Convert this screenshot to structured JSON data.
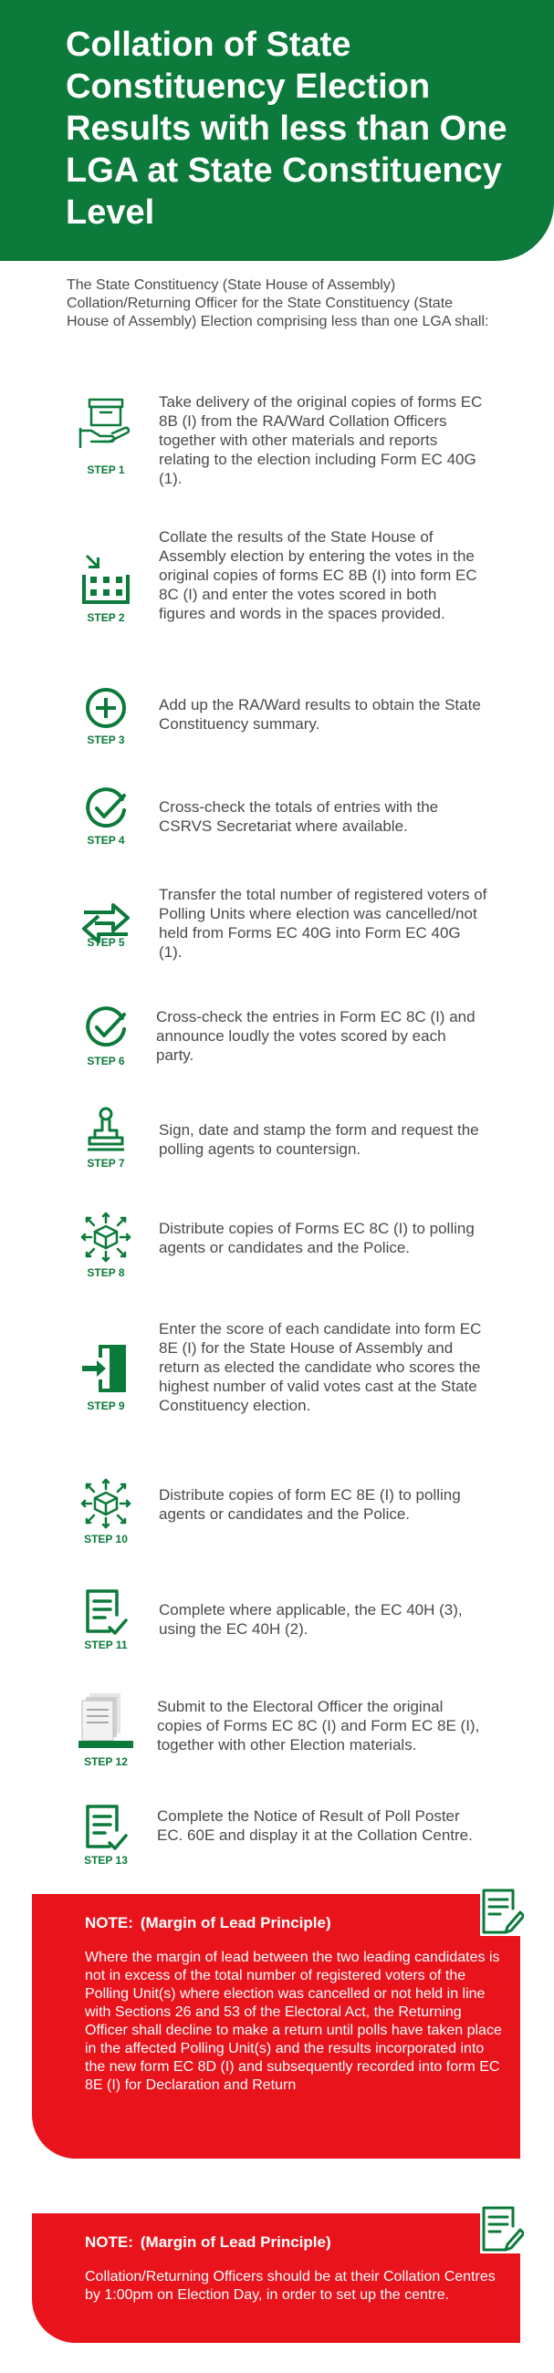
{
  "title": "Collation of State Constituency Election Results with less than One LGA at State Constituency Level",
  "intro": "The State Constituency (State House of Assembly) Collation/Returning Officer for the State Constituency (State House of Assembly) Election comprising less than one LGA shall:",
  "steps": [
    {
      "label": "STEP 1",
      "icon": "delivery-box-icon",
      "text": "Take delivery of the original copies of forms EC 8B (I) from the RA/Ward Collation Officers together with other materials and reports relating to the election including Form EC 40G (1)."
    },
    {
      "label": "STEP 2",
      "icon": "collate-grid-icon",
      "text": "Collate the results of the State House of Assembly election by entering the votes in the original copies of forms EC 8B (I) into form EC 8C (I) and enter the votes scored in both figures and words in the spaces provided."
    },
    {
      "label": "STEP 3",
      "icon": "plus-circle-icon",
      "text": "Add up the RA/Ward results to obtain the State Constituency summary."
    },
    {
      "label": "STEP 4",
      "icon": "check-circle-icon",
      "text": "Cross-check the totals of entries with the CSRVS Secretariat where available."
    },
    {
      "label": "STEP 5",
      "icon": "transfer-arrows-icon",
      "text": "Transfer the total number of registered voters of Polling Units where election was cancelled/not held from Forms EC 40G into Form EC 40G (1)."
    },
    {
      "label": "STEP 6",
      "icon": "check-circle-icon",
      "text": "Cross-check the entries in Form EC 8C (I) and announce loudly the votes scored by each party."
    },
    {
      "label": "STEP 7",
      "icon": "stamp-icon",
      "text": "Sign, date and stamp the form and request the polling agents to countersign."
    },
    {
      "label": "STEP 8",
      "icon": "distribute-icon",
      "text": "Distribute copies of Forms EC 8C (I) to polling agents or candidates and the Police."
    },
    {
      "label": "STEP 9",
      "icon": "door-enter-icon",
      "text": "Enter the score of each candidate into form EC 8E (I) for the State House of Assembly and return as elected the candidate who scores the highest number of valid votes cast at the State Constituency election."
    },
    {
      "label": "STEP 10",
      "icon": "distribute-icon",
      "text": "Distribute copies of form EC 8E (I) to polling agents or candidates and the Police."
    },
    {
      "label": "STEP 11",
      "icon": "checklist-document-icon",
      "text": "Complete where applicable, the EC 40H (3), using the EC 40H (2)."
    },
    {
      "label": "STEP 12",
      "icon": "document-stack-icon",
      "text": "Submit to the Electoral Officer the original copies of Forms EC 8C (I) and Form EC 8E (I), together with other Election materials."
    },
    {
      "label": "STEP 13",
      "icon": "checklist-document-icon",
      "text": "Complete the Notice of Result of Poll Poster EC. 60E and display it at the Collation Centre."
    }
  ],
  "notes": [
    {
      "prefix": "NOTE:",
      "heading": "(Margin of Lead Principle)",
      "icon": "document-pen-icon",
      "body": "Where the margin of lead between the two leading candidates is not in excess of the total number of registered voters of the Polling Unit(s) where election was cancelled or not held in line with Sections 26 and 53 of the Electoral Act, the Returning Officer shall decline to make a return until polls have taken place in the affected Polling Unit(s) and the results incorporated into the new form EC 8D (I) and subsequently recorded into form EC 8E (I) for Declaration and Return"
    },
    {
      "prefix": "NOTE:",
      "heading": "(Margin of Lead Principle)",
      "icon": "document-pen-icon",
      "body": "Collation/Returning Officers should be at their Collation Centres by 1:00pm on Election Day, in order to set up the centre."
    }
  ],
  "colors": {
    "green": "#0c7a3a",
    "red": "#e8131b",
    "text": "#4a4a4a"
  }
}
